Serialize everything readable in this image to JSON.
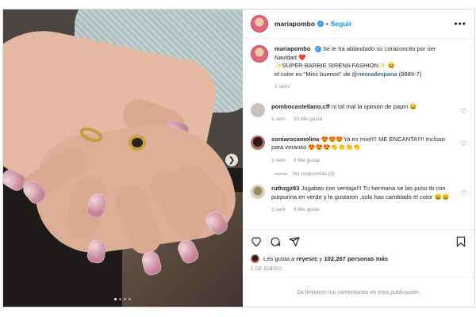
{
  "post": {
    "username": "mariapombo",
    "follow_label": "Seguir",
    "more_icon": "more-horizontal-icon"
  },
  "caption": {
    "username": "mariapombo",
    "line1": "Se le ha ablandado su corazoncito por ser Navidad ❤️",
    "line2": "✨SÚPER BARBIE SIRENA FASHION✨ 😄",
    "line3_prefix": "el color es \"Miss buenos\" de ",
    "line3_link": "@neonailespana",
    "line3_suffix": " (8889-7)",
    "time": "1 sem"
  },
  "comments": [
    {
      "username": "pombocastellano.cff",
      "text": "ni tal mal la opinión de papin 😄",
      "time": "1 sem",
      "likes": "33 Me gusta"
    },
    {
      "username": "soniarocamolina",
      "text": "😍😍😍Ya es mío!!!! ME ENCANTA!!!! Incluso para veranito 😍😍😍👏👏👏👏",
      "time": "1 sem",
      "likes": "3 Me gusta",
      "replies": "Ver respuestas (3)"
    },
    {
      "username": "ruthzgz83",
      "text": "Jugabas con ventaja!!! Tu hermana se las puso tb con purpurina en verde y le gustaron ,solo has cambiado el color 😄😄",
      "time": "1 sem",
      "likes": "8 Me gusta"
    }
  ],
  "likes": {
    "prefix": "Les gusta a ",
    "user": "reyesrc",
    "middle": " y ",
    "count": "102,267 personas más"
  },
  "date": "5 DE ENERO",
  "comments_disabled": "Se limitaron los comentarios en esta publicación.",
  "colors": {
    "accent": "#0095f6",
    "verified": "#3897f0",
    "muted": "#8e8e8e"
  }
}
